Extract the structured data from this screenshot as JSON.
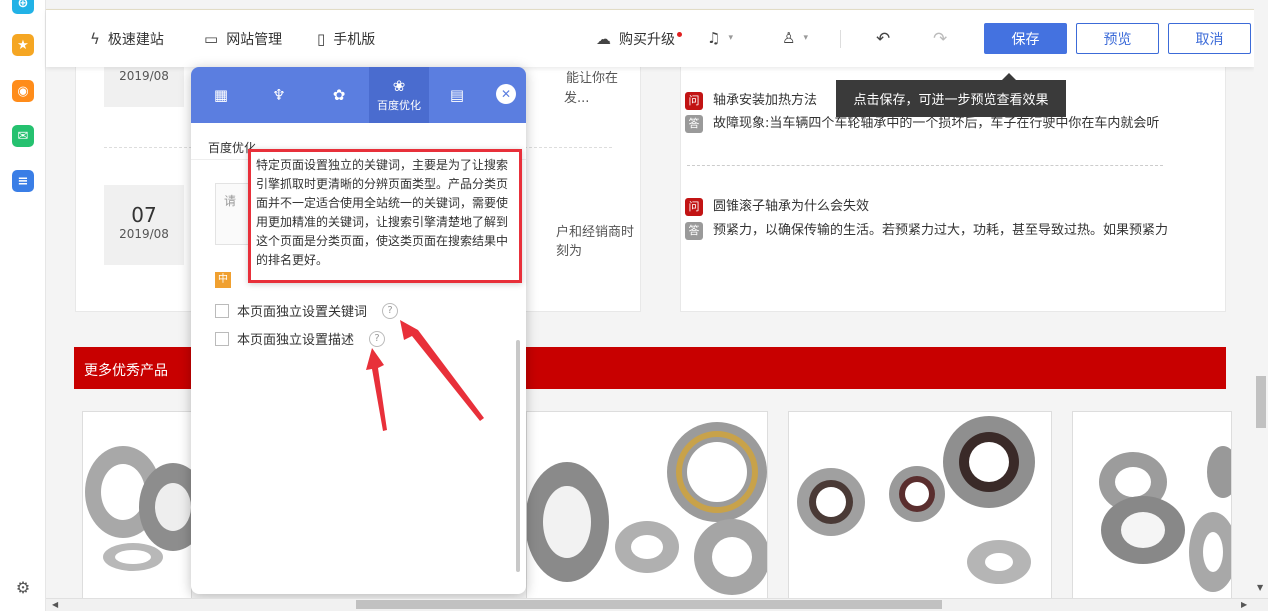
{
  "toolbar": {
    "site_build": "极速建站",
    "site_manage": "网站管理",
    "mobile": "手机版",
    "upgrade": "购买升级",
    "save": "保存",
    "preview": "预览",
    "cancel": "取消"
  },
  "tooltip": "点击保存，可进一步预览查看效果",
  "news": [
    {
      "day": "",
      "ym": "2019/08"
    },
    {
      "day": "07",
      "ym": "2019/08"
    }
  ],
  "news_text": {
    "line1": "能让你在",
    "line2": "发...",
    "line3": "户和经销商时刻为"
  },
  "qa": [
    {
      "q_badge": "问",
      "q": "轴承安装加热方法",
      "a_badge": "答",
      "a": "故障现象:当车辆四个车轮轴承中的一个损坏后，车子在行驶中你在车内就会听"
    },
    {
      "q_badge": "问",
      "q": "圆锥滚子轴承为什么会失效",
      "a_badge": "答",
      "a": "预紧力，以确保传输的生活。若预紧力过大，功耗，甚至导致过热。如果预紧力"
    }
  ],
  "banner": "更多优秀产品",
  "panel": {
    "active_tab": "百度优化",
    "section": "百度优化",
    "input_placeholder": "请",
    "lang_badge": "中",
    "check1": "本页面独立设置关键词",
    "check2": "本页面独立设置描述",
    "help_mark": "?",
    "help_text": "特定页面设置独立的关键词，主要是为了让搜索引擎抓取时更清晰的分辨页面类型。产品分类页面并不一定适合使用全站统一的关键词，需要使用更加精准的关键词，让搜索引擎清楚地了解到这个页面是分类页面，使这类页面在搜索结果中的排名更好。"
  },
  "colors": {
    "primary": "#5b7ee0",
    "banner_red": "#c80000",
    "highlight_red": "#e8303a"
  }
}
